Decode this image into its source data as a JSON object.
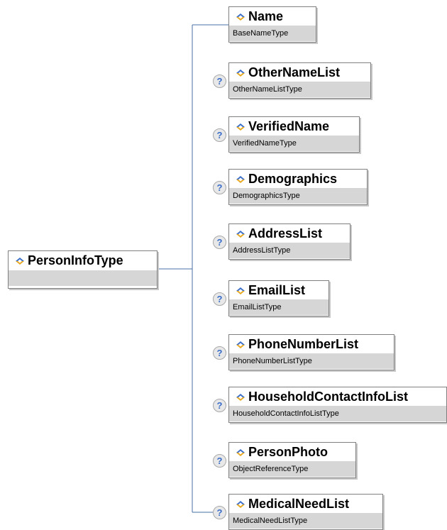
{
  "root": {
    "name": "PersonInfoType",
    "icon": "element-icon"
  },
  "colors": {
    "type_band": "#d6d6d6",
    "border": "#808080",
    "connector": "#4a6fa5",
    "icon_blue": "#3a6ec8",
    "icon_gold": "#e8a820",
    "optional_badge_bg": "#e8e8e8"
  },
  "optional_badge_symbol": "?",
  "elements": [
    {
      "name": "Name",
      "type": "BaseNameType",
      "optional": false,
      "icon": "element-icon"
    },
    {
      "name": "OtherNameList",
      "type": "OtherNameListType",
      "optional": true,
      "icon": "element-icon"
    },
    {
      "name": "VerifiedName",
      "type": "VerifiedNameType",
      "optional": true,
      "icon": "element-icon"
    },
    {
      "name": "Demographics",
      "type": "DemographicsType",
      "optional": true,
      "icon": "element-icon"
    },
    {
      "name": "AddressList",
      "type": "AddressListType",
      "optional": true,
      "icon": "element-icon"
    },
    {
      "name": "EmailList",
      "type": "EmailListType",
      "optional": true,
      "icon": "element-icon"
    },
    {
      "name": "PhoneNumberList",
      "type": "PhoneNumberListType",
      "optional": true,
      "icon": "element-icon"
    },
    {
      "name": "HouseholdContactInfoList",
      "type": "HouseholdContactInfoListType",
      "optional": true,
      "icon": "element-icon"
    },
    {
      "name": "PersonPhoto",
      "type": "ObjectReferenceType",
      "optional": true,
      "icon": "element-icon"
    },
    {
      "name": "MedicalNeedList",
      "type": "MedicalNeedListType",
      "optional": true,
      "icon": "element-icon"
    }
  ]
}
